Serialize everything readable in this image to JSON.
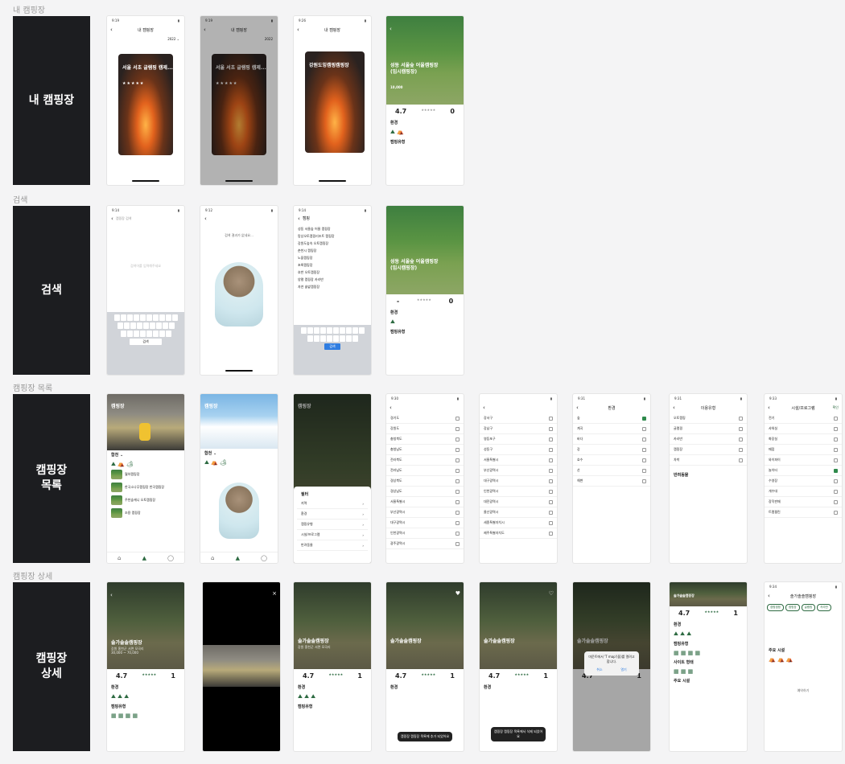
{
  "sections": [
    {
      "label": "내 캠핑장",
      "card": "내 캠핑장"
    },
    {
      "label": "검색",
      "card": "검색"
    },
    {
      "label": "캠핑장 목록",
      "card": "캠핑장\n목록"
    },
    {
      "label": "캠핑장 상세",
      "card": "캠핑장\n상세"
    }
  ],
  "row1": {
    "time1": "9:19",
    "time2": "9:19",
    "time3": "9:26",
    "title": "내 캠핑장",
    "year": "2022",
    "card1_title": "서울 서초 글램핑 캠제...",
    "card2_title": "서울 서초 글램핑 캠제...",
    "card3_title": "강원도밍캠핑캠핑장",
    "detail_title": "성동 서울숲 어울캠핑장\n(임시캠핑장)",
    "detail_price": "10,000",
    "detail_env": "환경",
    "detail_type": "캠핑유형",
    "rating": "4.7",
    "count": "0",
    "stars": "★★★★★"
  },
  "row2": {
    "time1": "9:14",
    "time2": "9:12",
    "time3": "9:14",
    "placeholder": "캠핑장 검색",
    "hint": "검색어를 입력해주세요",
    "no_result": "검색 결과가 없네요...",
    "query": "캠핑",
    "search_btn": "검색",
    "results": [
      "성동 서울숲 어울 캠핑장",
      "망상오토캠핑리조트 캠핑장",
      "강원도숲속 오토캠핑장",
      "춘천시 캠핑장",
      "노을캠핑장",
      "초록캠핑장",
      "호반 오토캠핑장",
      "양평 캠핑장 카라반",
      "자연 솔밭캠핑장"
    ],
    "detail_title": "성동 서울숲 어울캠핑장\n(임시캠핑장)"
  },
  "row3": {
    "app_title": "캠핑장",
    "region": "합천",
    "camps": [
      "월하캠핑장",
      "한국소나무캠핑장 반곡캠핑장",
      "주천숲캐니 오토캠핑장",
      "조용 캠핑장"
    ],
    "overlay_title": "필터",
    "filter_items": [
      "지역",
      "환경",
      "캠핑유형",
      "시설/프로그램",
      "반려동물"
    ],
    "regions_a": [
      "경기도",
      "강원도",
      "충청북도",
      "충청남도",
      "전라북도",
      "전라남도",
      "경상북도",
      "경상남도",
      "서울특별시",
      "부산광역시",
      "대구광역시",
      "인천광역시",
      "광주광역시"
    ],
    "regions_b": [
      "강서구",
      "강남구",
      "영등포구",
      "성동구",
      "서울특별시",
      "부산광역시",
      "대구광역시",
      "인천광역시",
      "대전광역시",
      "울산광역시",
      "세종특별자치시",
      "제주특별자치도"
    ],
    "env_title": "환경",
    "env_items": [
      "숲",
      "계곡",
      "바다",
      "강",
      "호수",
      "산",
      "해변"
    ],
    "type_title": "이용유형",
    "type_items": [
      "오토캠핑",
      "글램핑",
      "카라반",
      "캠핑장",
      "차박"
    ],
    "pet_title": "반려동물",
    "facility_title": "시설/프로그램",
    "facility_items": [
      "전기",
      "샤워실",
      "화장실",
      "매점",
      "와이파이",
      "놀이터",
      "수영장",
      "개수대",
      "장작판매",
      "트램펄린"
    ],
    "confirm": "확인",
    "times": [
      "9:30",
      "9:31",
      "9:31",
      "9:33"
    ]
  },
  "row4": {
    "camp_name": "솔가솔솔캠핑장",
    "address": "강원 홍천군 서면 모곡리",
    "price": "30,000 ~ 70,000",
    "rating": "4.7",
    "count": "1",
    "env": "환경",
    "type": "캠핑유형",
    "site": "사이트 형태",
    "facility": "주요 시설",
    "toast1": "캠핑장 캠핑장 목록에 추가 되었어요",
    "toast2": "캠핑장 캠핑장 목록에서 삭제 되었어요",
    "dialog": "마운트에서 'T map'(을)를 열려고 합니다.",
    "cancel": "취소",
    "open": "열기",
    "chips": [
      "캠핑캠핑",
      "캠핑장",
      "글램핑",
      "카라반"
    ],
    "time": "9:34",
    "reserve": "예약하기"
  }
}
